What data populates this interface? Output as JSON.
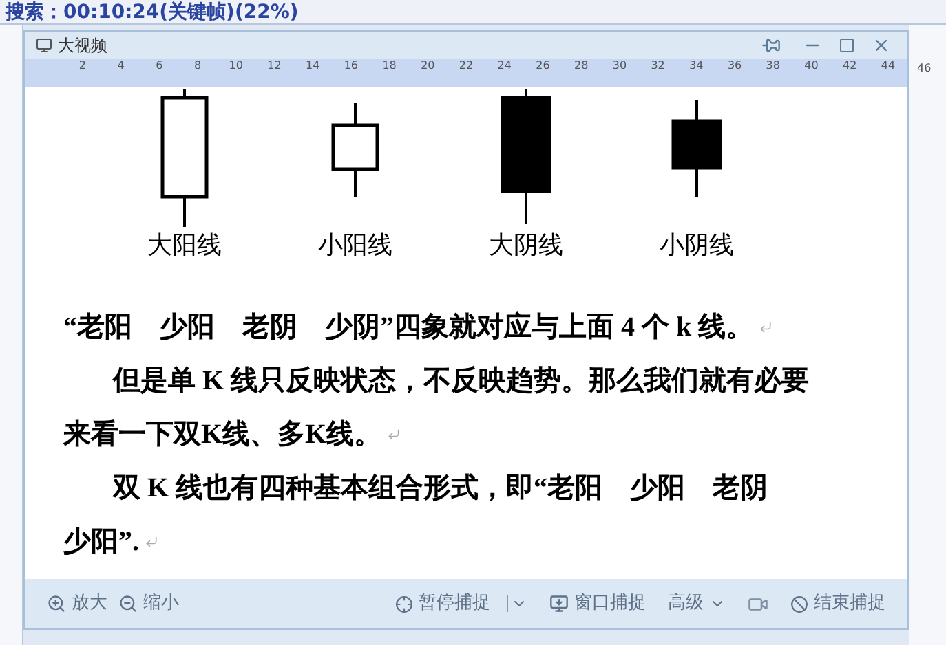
{
  "overlay_caption": "搜索：00:10:24(关键帧)(22%)",
  "window": {
    "title": "大视频"
  },
  "ruler": {
    "labels": [
      "2",
      "4",
      "6",
      "8",
      "10",
      "12",
      "14",
      "16",
      "18",
      "20",
      "22",
      "24",
      "26",
      "28",
      "30",
      "32",
      "34",
      "36",
      "38",
      "40",
      "42",
      "44"
    ],
    "outside_label": "46"
  },
  "candles": [
    {
      "kind": "big_hollow",
      "label": "大阳线"
    },
    {
      "kind": "small_hollow",
      "label": "小阳线"
    },
    {
      "kind": "big_filled",
      "label": "大阴线"
    },
    {
      "kind": "small_filled",
      "label": "小阴线"
    }
  ],
  "lines": [
    {
      "text": "“老阳　少阳　老阴　少阴”四象就对应与上面 4 个 k 线。",
      "indent": false,
      "mark": true
    },
    {
      "text": "但是单 K 线只反映状态，不反映趋势。那么我们就有必要",
      "indent": true,
      "mark": false
    },
    {
      "text": "来看一下双K线、多K线。",
      "indent": false,
      "mark": true
    },
    {
      "text": "双 K 线也有四种基本组合形式，即“老阳　少阳　老阴",
      "indent": true,
      "mark": false
    },
    {
      "text": "少阳”.",
      "indent": false,
      "mark": true
    }
  ],
  "toolbar": {
    "left": [
      {
        "kind": "zoom_in",
        "label": "放大"
      },
      {
        "kind": "zoom_out",
        "label": "缩小"
      }
    ],
    "right": [
      {
        "kind": "pause",
        "label": "暂停捕捉"
      },
      {
        "kind": "window",
        "label": "窗口捕捉"
      },
      {
        "kind": "advanced",
        "label": "高级"
      },
      {
        "kind": "camera"
      },
      {
        "kind": "stop",
        "label": "结束捕捉"
      }
    ]
  }
}
